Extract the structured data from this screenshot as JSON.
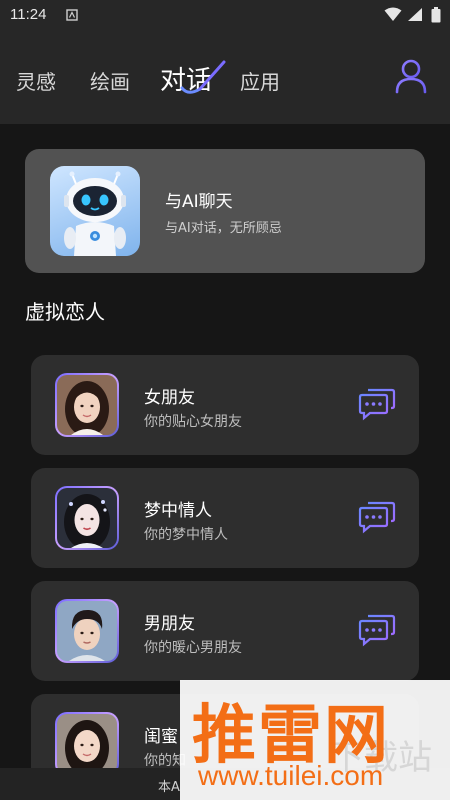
{
  "status_bar": {
    "time": "11:24"
  },
  "nav": {
    "tabs": [
      {
        "label": "灵感"
      },
      {
        "label": "绘画"
      },
      {
        "label": "对话",
        "active": true
      },
      {
        "label": "应用"
      }
    ],
    "profile_icon": "user-icon"
  },
  "ai_chat_card": {
    "title": "与AI聊天",
    "subtitle": "与AI对话，无所顾忌"
  },
  "section": {
    "title": "虚拟恋人"
  },
  "companions": [
    {
      "title": "女朋友",
      "subtitle": "你的贴心女朋友"
    },
    {
      "title": "梦中情人",
      "subtitle": "你的梦中情人"
    },
    {
      "title": "男朋友",
      "subtitle": "你的暖心男朋友"
    },
    {
      "title": "闺蜜",
      "subtitle": "你的知"
    }
  ],
  "bottom": {
    "note": "本A"
  },
  "watermark": {
    "brand": "推雷网",
    "faint": "下载站",
    "url": "www.tuilei.com"
  },
  "colors": {
    "accent": "#7a6cff",
    "card": "#2e2e2e",
    "watermark": "#f36e16"
  }
}
